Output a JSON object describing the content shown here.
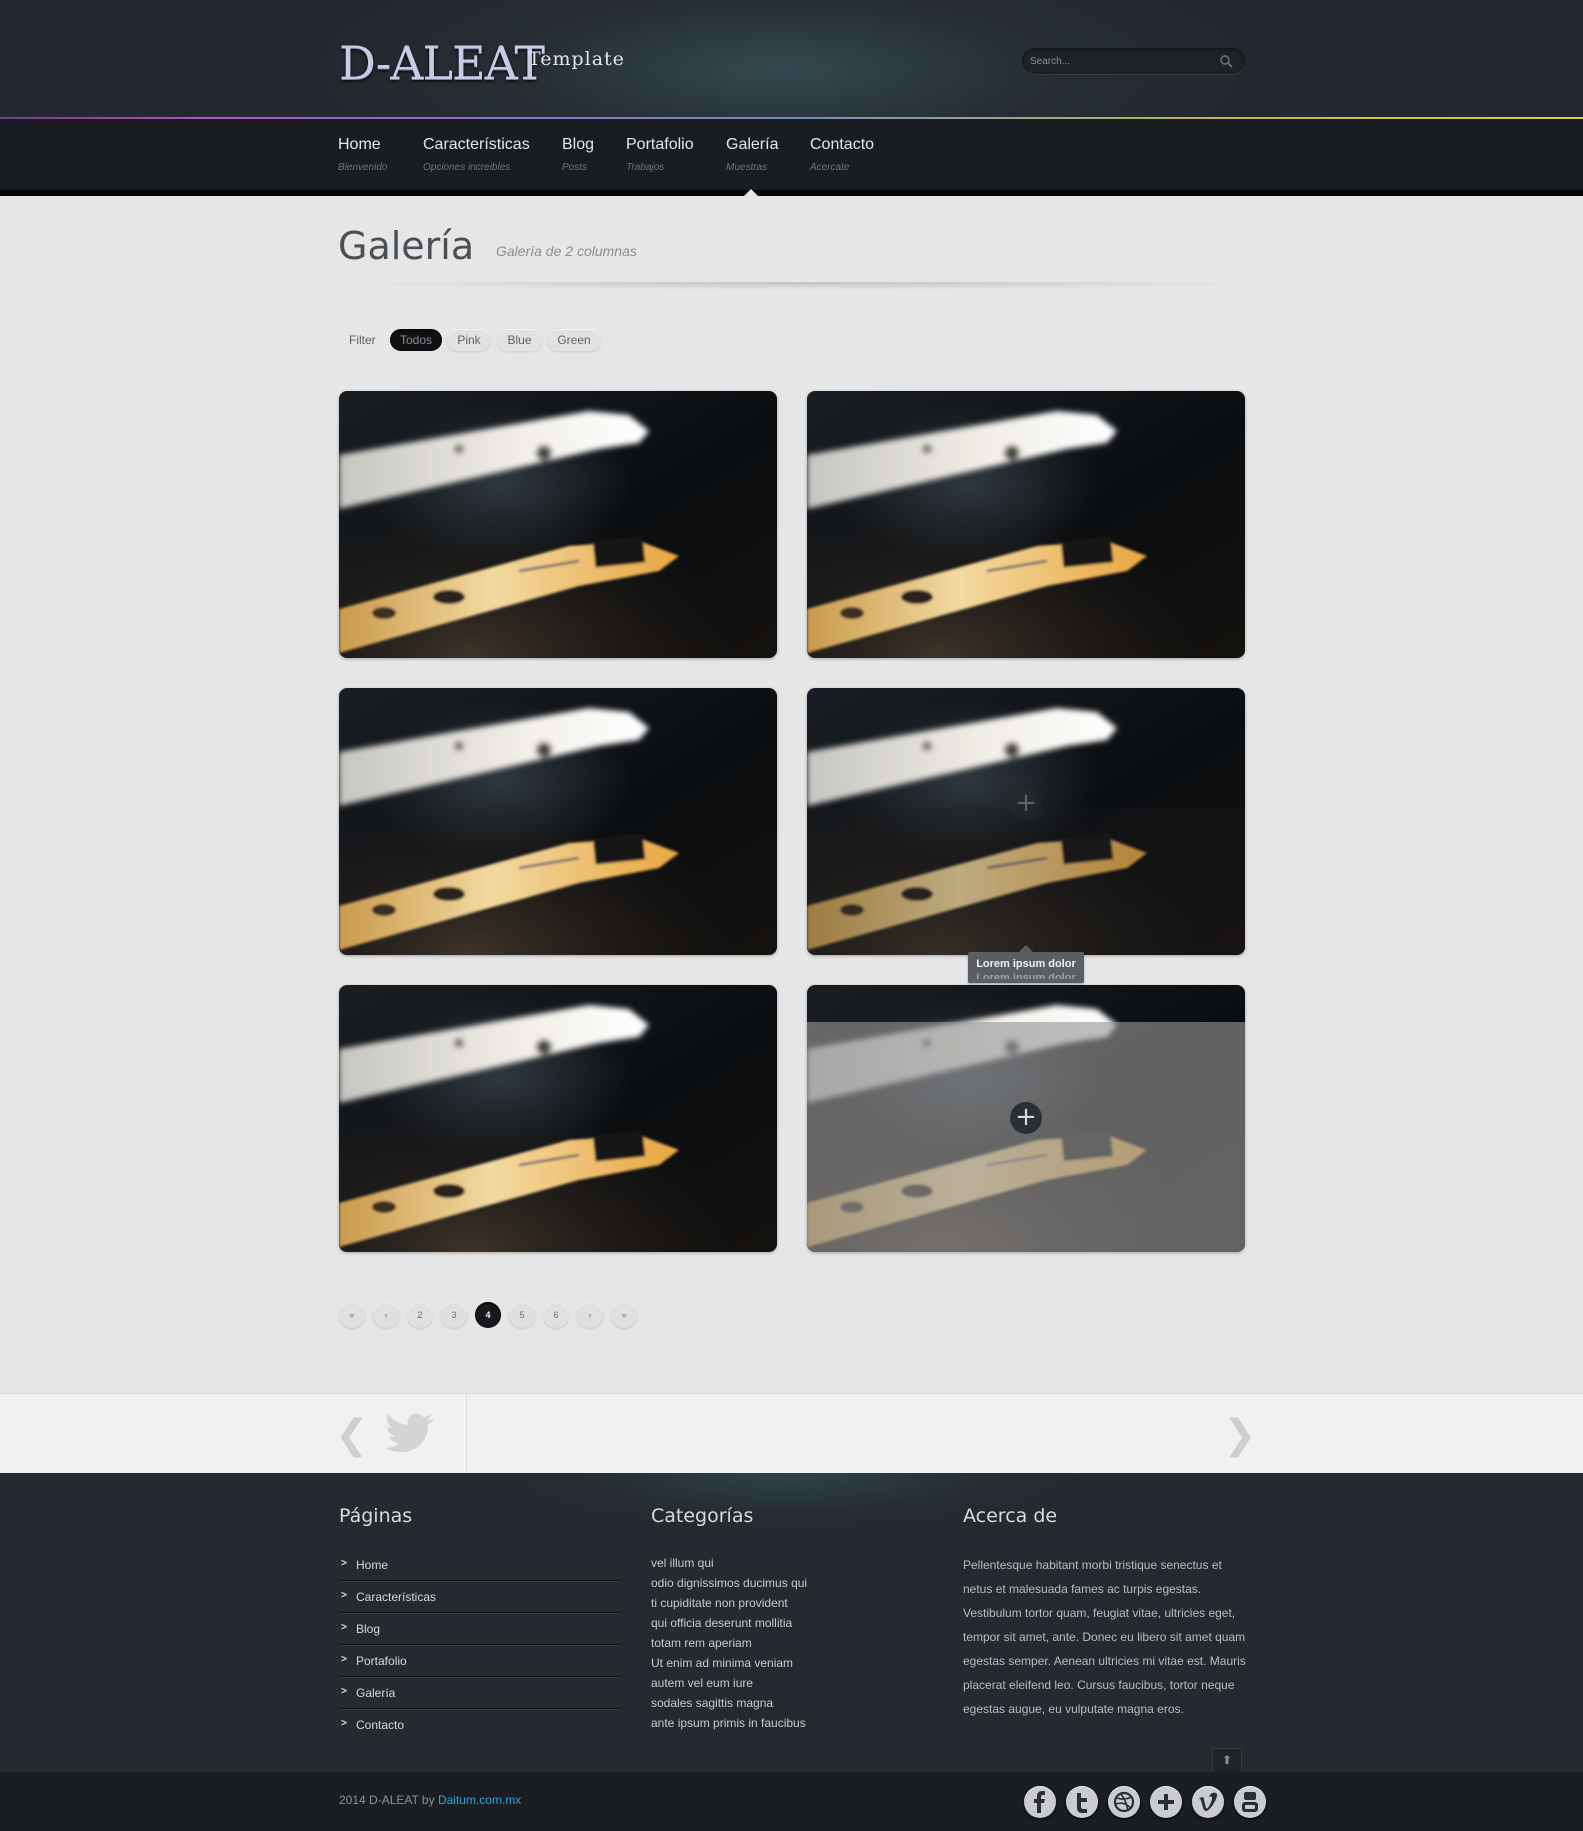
{
  "header": {
    "logo": "D-ALEAT",
    "logo_sub": "Template",
    "search_placeholder": "Search..."
  },
  "nav": [
    {
      "label": "Home",
      "sub": "Bienvenido"
    },
    {
      "label": "Características",
      "sub": "Opciones increibles"
    },
    {
      "label": "Blog",
      "sub": "Posts"
    },
    {
      "label": "Portafolio",
      "sub": "Trabajos"
    },
    {
      "label": "Galería",
      "sub": "Muestras"
    },
    {
      "label": "Contacto",
      "sub": "Acercate"
    }
  ],
  "page": {
    "title": "Galería",
    "subtitle": "Galería de 2 columnas"
  },
  "filter": {
    "label": "Filter",
    "options": [
      "Todos",
      "Pink",
      "Blue",
      "Green"
    ],
    "selected": "Todos"
  },
  "gallery": {
    "tooltip": "Lorem ipsum dolor",
    "tooltip_ghost": "Lorem ipsum dolor",
    "plus": "+"
  },
  "pagination": [
    "«",
    "‹",
    "2",
    "3",
    "4",
    "5",
    "6",
    "›",
    "»"
  ],
  "pagination_active": "4",
  "twitter": {
    "prev": "❮",
    "next": "❯"
  },
  "footer": {
    "pages_title": "Páginas",
    "pages": [
      "Home",
      "Características",
      "Blog",
      "Portafolio",
      "Galería",
      "Contacto"
    ],
    "categories_title": "Categorías",
    "categories": [
      "vel illum qui",
      "odio dignissimos ducimus qui",
      "ti cupiditate non provident",
      "qui officia deserunt mollitia",
      "totam rem aperiam",
      "Ut enim ad minima veniam",
      "autem vel eum iure",
      "sodales sagittis magna",
      "ante ipsum primis in faucibus"
    ],
    "about_title": "Acerca de",
    "about_text": "Pellentesque habitant morbi tristique senectus et netus et malesuada fames ac turpis egestas. Vestibulum tortor quam, feugiat vitae, ultricies eget, tempor sit amet, ante. Donec eu libero sit amet quam egestas semper. Aenean ultricies mi vitae est. Mauris placerat eleifend leo. Cursus faucibus, tortor neque egestas augue, eu vulputate magna eros.",
    "to_top": "⬆",
    "copyright_prefix": "2014 D-ALEAT by ",
    "copyright_brand": "Daitum.com.mx",
    "social": [
      "facebook-icon",
      "twitter-icon",
      "dribbble-icon",
      "plus-icon",
      "vimeo-icon",
      "youtube-icon"
    ]
  },
  "colors": {
    "header_bg": "#262d33",
    "nav_bg": "#191d21",
    "page_bg": "#e6e6e6",
    "footer_bg": "#252b31",
    "link_accent": "#36a6d6"
  }
}
